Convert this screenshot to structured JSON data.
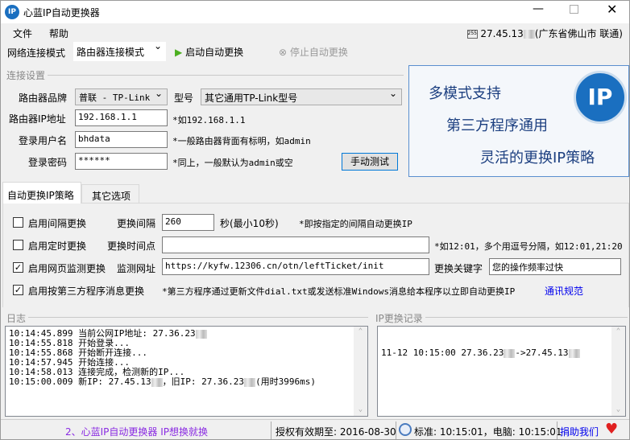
{
  "title": "心蓝IP自动更换器",
  "menu": [
    "文件",
    "帮助"
  ],
  "ip_status": {
    "ip": "27.45.13",
    "location": "(广东省佛山市 联通)"
  },
  "toolbar": {
    "mode_label": "网络连接模式",
    "mode_value": "路由器连接模式",
    "start": "启动自动更换",
    "stop": "停止自动更换"
  },
  "conn": {
    "group": "连接设置",
    "brand_label": "路由器品牌",
    "brand_value": "普联 - TP-Link",
    "model_label": "型号",
    "model_value": "其它通用TP-Link型号",
    "ip_label": "路由器IP地址",
    "ip_value": "192.168.1.1",
    "ip_hint": "*如192.168.1.1",
    "user_label": "登录用户名",
    "user_value": "bhdata",
    "user_hint": "*一般路由器背面有标明，如admin",
    "pwd_label": "登录密码",
    "pwd_value": "******",
    "pwd_hint": "*同上，一般默认为admin或空",
    "test_button": "手动测试"
  },
  "banner": {
    "line1": "多模式支持",
    "line2": "第三方程序通用",
    "line3": "灵活的更换IP策略",
    "logo": "IP"
  },
  "tabs": [
    "自动更换IP策略",
    "其它选项"
  ],
  "strategy": {
    "interval_chk": "启用间隔更换",
    "interval_label": "更换间隔",
    "interval_value": "260",
    "interval_unit": "秒(最小10秒)",
    "interval_hint": "*即按指定的间隔自动更换IP",
    "timed_chk": "启用定时更换",
    "timed_label": "更换时间点",
    "timed_value": "",
    "timed_hint": "*如12:01，多个用逗号分隔，如12:01,21:20",
    "web_chk": "启用网页监测更换",
    "web_label": "监测网址",
    "web_value": "https://kyfw.12306.cn/otn/leftTicket/init",
    "kw_label": "更换关键字",
    "kw_value": "您的操作频率过快",
    "third_chk": "启用按第三方程序消息更换",
    "third_hint": "*第三方程序通过更新文件dial.txt或发送标准Windows消息给本程序以立即自动更换IP",
    "third_link": "通讯规范"
  },
  "log": {
    "title": "日志",
    "lines": [
      "10:14:45.899 当前公网IP地址: 27.36.23",
      "10:14:55.818 开始登录...",
      "10:14:55.868 开始断开连接...",
      "10:14:57.945 开始连接...",
      "10:14:58.013 连接完成，检测新的IP...",
      "10:15:00.009 新IP: 27.45.13",
      "，旧IP: 27.36.23",
      "(用时3996ms)"
    ]
  },
  "history": {
    "title": "IP更换记录",
    "lines": [
      "11-12 10:15:00 27.36.23",
      "->27.45.13"
    ]
  },
  "status": {
    "link": "2、心蓝IP自动更换器 IP想换就换",
    "license": "授权有效期至: 2016-08-30",
    "time": "标准: 10:15:01，电脑: 10:15:01",
    "donate": "捐助我们"
  }
}
